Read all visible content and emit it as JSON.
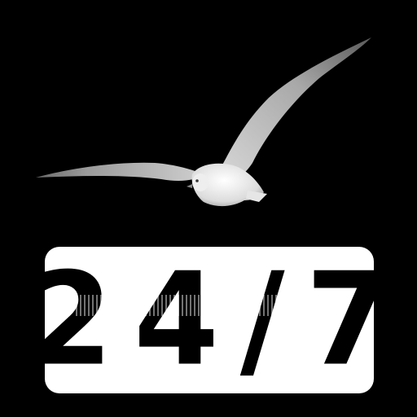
{
  "image": {
    "subject": "seagull-in-flight",
    "background_color": "#000000",
    "badge_color": "#ffffff",
    "text_color": "#000000"
  },
  "badge": {
    "label": "24/7"
  }
}
